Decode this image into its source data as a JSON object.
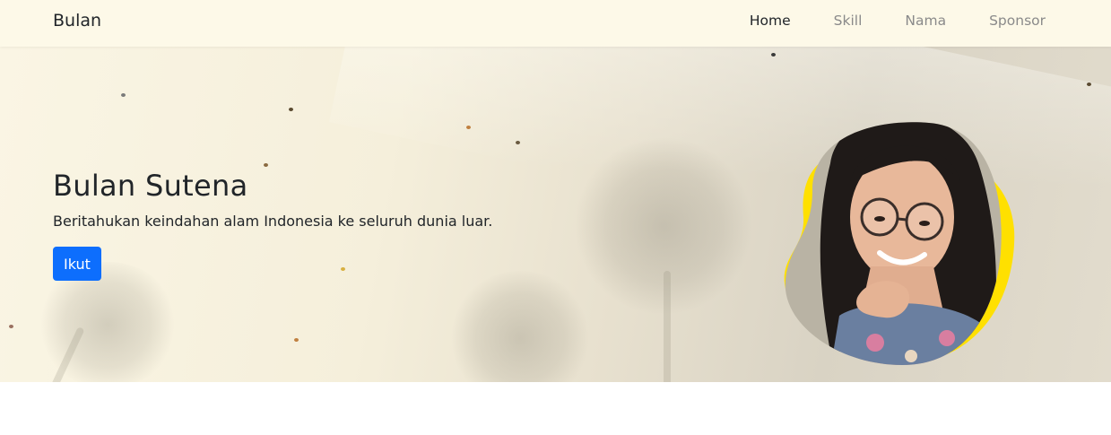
{
  "navbar": {
    "brand": "Bulan",
    "links": [
      {
        "label": "Home",
        "active": true
      },
      {
        "label": "Skill",
        "active": false
      },
      {
        "label": "Nama",
        "active": false
      },
      {
        "label": "Sponsor",
        "active": false
      }
    ]
  },
  "hero": {
    "title": "Bulan Sutena",
    "subtitle": "Beritahukan keindahan alam Indonesia ke seluruh dunia luar.",
    "button_label": "Ikut"
  },
  "colors": {
    "navbar_bg": "#fdf9e8",
    "button": "#0d6efd",
    "accent_blob": "#ffe000"
  },
  "icons": [
    "profile-photo"
  ]
}
